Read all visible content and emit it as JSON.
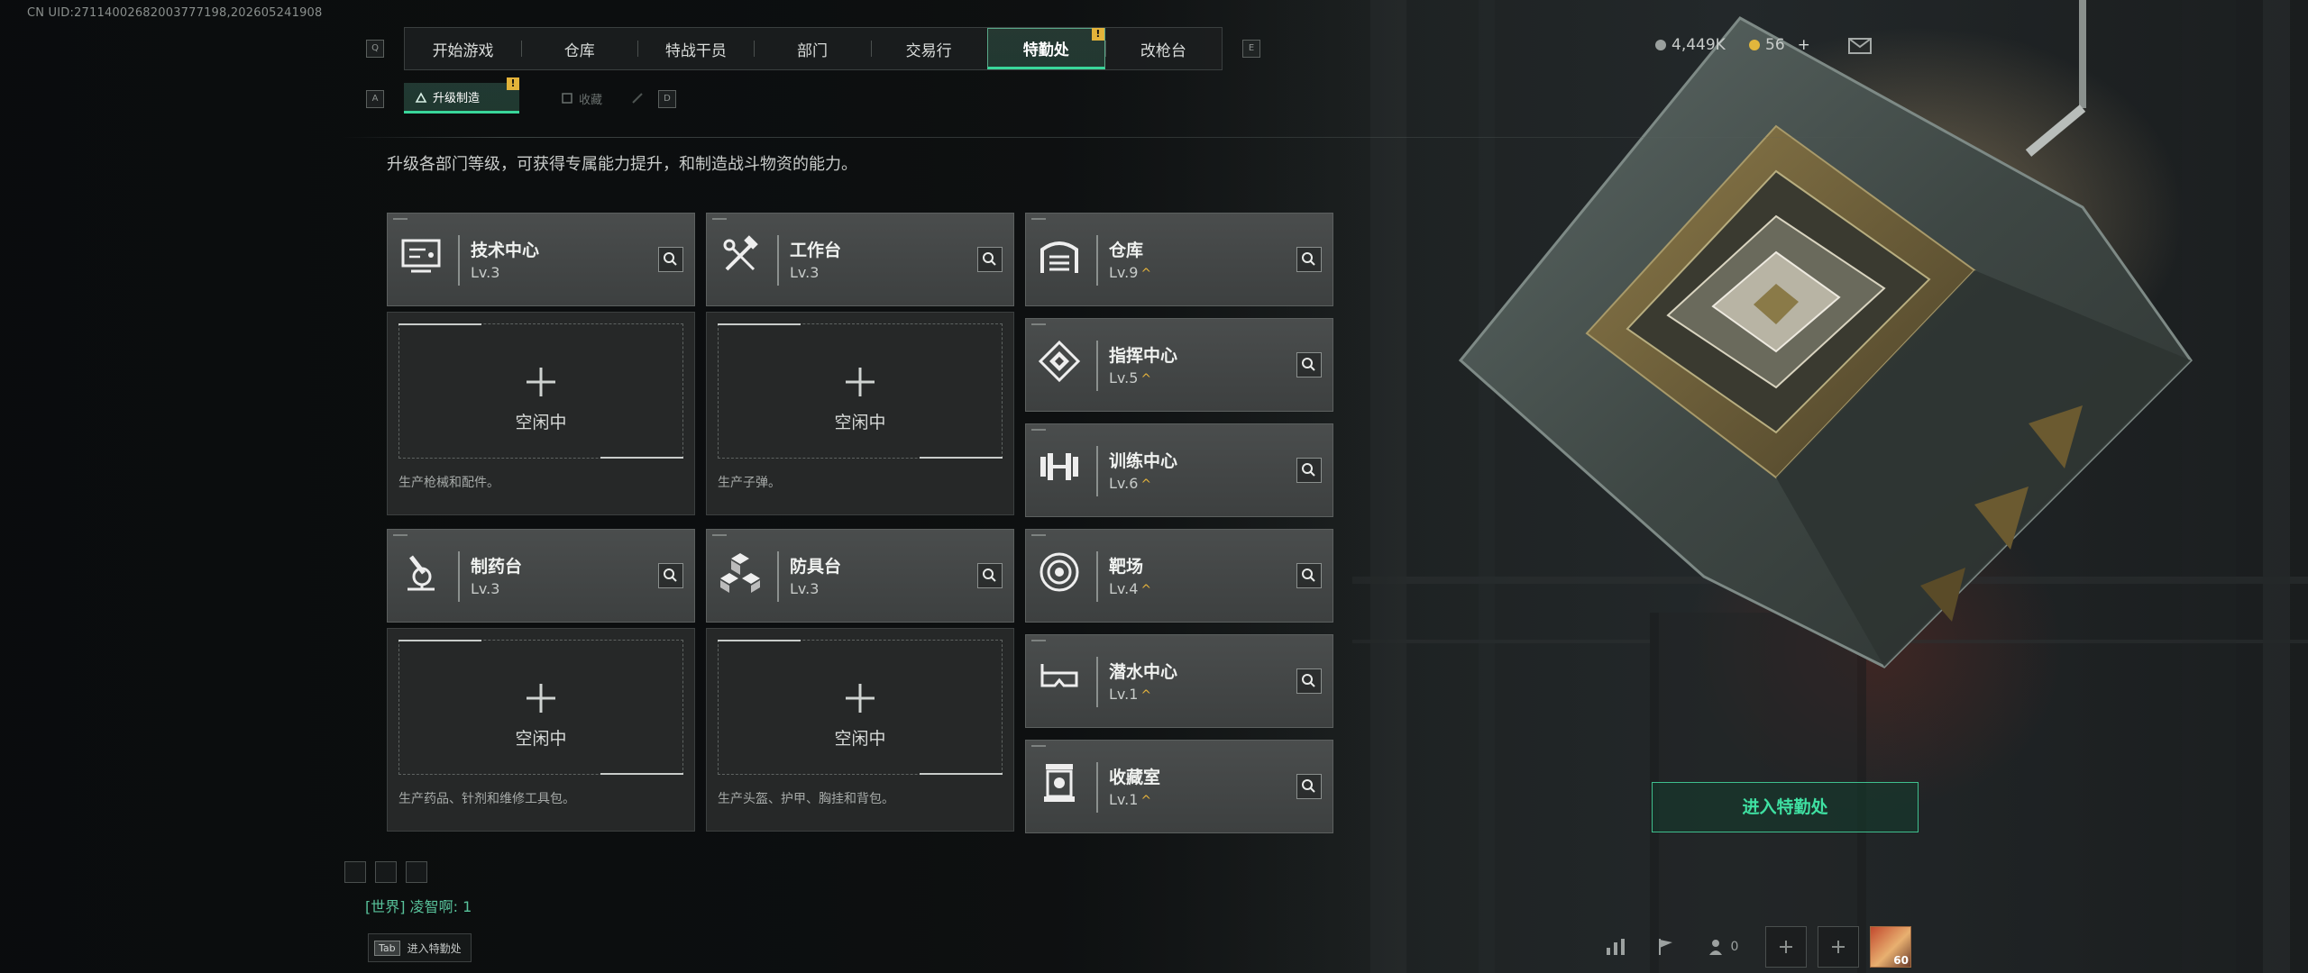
{
  "uid_text": "CN UID:27114002682003777198,202605241908",
  "top_nav": {
    "left_key": "Q",
    "right_key": "E",
    "tabs": [
      {
        "label": "开始游戏"
      },
      {
        "label": "仓库"
      },
      {
        "label": "特战干员"
      },
      {
        "label": "部门"
      },
      {
        "label": "交易行"
      },
      {
        "label": "特勤处",
        "active": true,
        "badge": "!"
      },
      {
        "label": "改枪台"
      }
    ]
  },
  "sub_nav": {
    "left_key": "A",
    "right_key": "D",
    "tabs": [
      {
        "label": "升级制造",
        "active": true,
        "badge": "!"
      },
      {
        "label": "收藏"
      }
    ]
  },
  "currency": {
    "primary": "4,449K",
    "secondary": "56",
    "add_label": "+"
  },
  "description": "升级各部门等级，可获得专属能力提升，和制造战斗物资的能力。",
  "production_facilities": [
    {
      "name": "技术中心",
      "level": "Lv.3",
      "icon": "computer-icon",
      "slot_status": "空闲中",
      "slot_description": "生产枪械和配件。"
    },
    {
      "name": "工作台",
      "level": "Lv.3",
      "icon": "tools-icon",
      "slot_status": "空闲中",
      "slot_description": "生产子弹。"
    },
    {
      "name": "制药台",
      "level": "Lv.3",
      "icon": "microscope-icon",
      "slot_status": "空闲中",
      "slot_description": "生产药品、针剂和维修工具包。"
    },
    {
      "name": "防具台",
      "level": "Lv.3",
      "icon": "cubes-icon",
      "slot_status": "空闲中",
      "slot_description": "生产头盔、护甲、胸挂和背包。"
    }
  ],
  "other_facilities": [
    {
      "name": "仓库",
      "level": "Lv.9",
      "upgradable": true,
      "icon": "garage-icon"
    },
    {
      "name": "指挥中心",
      "level": "Lv.5",
      "upgradable": true,
      "icon": "chip-icon"
    },
    {
      "name": "训练中心",
      "level": "Lv.6",
      "upgradable": true,
      "icon": "dumbbell-icon"
    },
    {
      "name": "靶场",
      "level": "Lv.4",
      "upgradable": true,
      "icon": "target-icon"
    },
    {
      "name": "潜水中心",
      "level": "Lv.1",
      "upgradable": true,
      "icon": "diving-mask-icon"
    },
    {
      "name": "收藏室",
      "level": "Lv.1",
      "upgradable": true,
      "icon": "trophy-case-icon"
    }
  ],
  "upgrade_marker": "^",
  "enter_button": "进入特勤处",
  "chat": {
    "channel": "[世界]",
    "text": "凌智啊: 1"
  },
  "tab_hint": {
    "key": "Tab",
    "label": "进入特勤处"
  },
  "friends_count": "0",
  "avatar_level": "60",
  "colors": {
    "accent": "#39d69a",
    "badge": "#e3b33a",
    "upgrade": "#e4b23c"
  }
}
